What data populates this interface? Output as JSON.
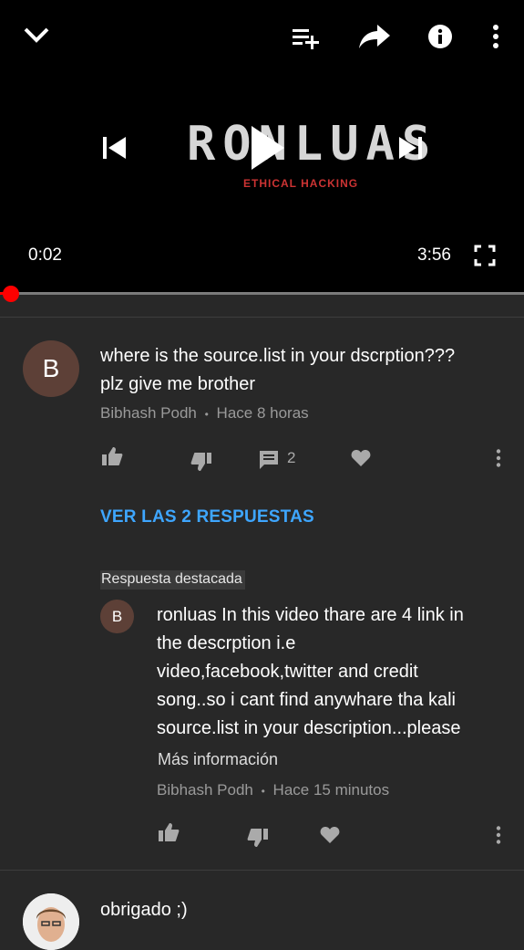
{
  "player": {
    "current_time": "0:02",
    "duration": "3:56",
    "progress_fraction": 0.0085,
    "video_logo_text": "RONLUAS",
    "video_logo_subtext": "ETHICAL HACKING"
  },
  "comment1": {
    "avatar_letter": "B",
    "text_line1": "where is the source.list in your dscrption???",
    "text_line2": "plz give me brother",
    "author": "Bibhash Podh",
    "time": "Hace 8 horas",
    "reply_count": "2",
    "view_replies_label": "VER LAS 2 RESPUESTAS"
  },
  "highlighted_reply": {
    "badge": "Respuesta destacada",
    "avatar_letter": "B",
    "lines": [
      "ronluas In this video thare are 4 link in",
      "the descrption i.e",
      "video,facebook,twitter and credit",
      "song..so i cant find anywhare tha kali",
      "source.list in your description...please"
    ],
    "more_label": "Más información",
    "author": "Bibhash Podh",
    "time": "Hace 15 minutos"
  },
  "comment2": {
    "text": "obrigado ;)"
  },
  "colors": {
    "background": "#282828",
    "player_bg": "#000000",
    "accent_blue": "#3ea6ff",
    "progress_red": "#ff0000",
    "avatar": "#5d4037"
  }
}
